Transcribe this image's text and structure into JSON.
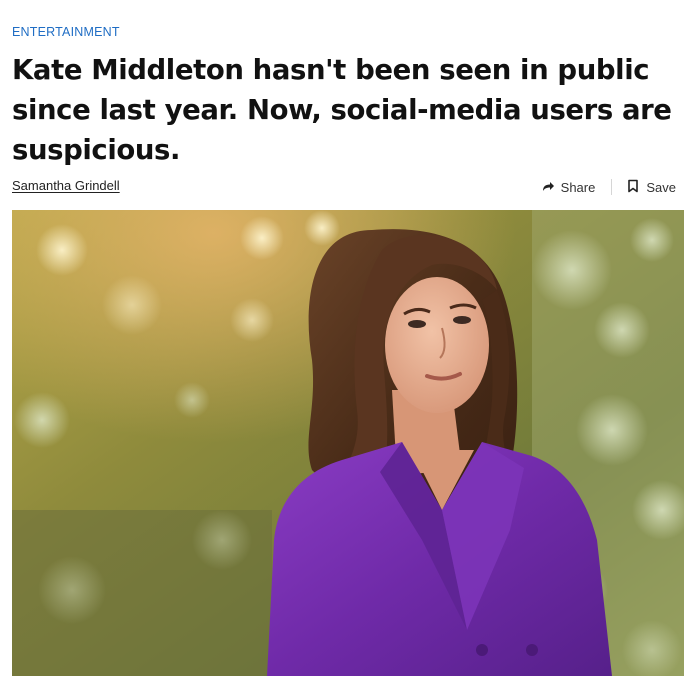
{
  "article": {
    "category": "ENTERTAINMENT",
    "headline": "Kate Middleton hasn't been seen in public since last year. Now, social-media users are suspicious.",
    "author": "Samantha Grindell"
  },
  "actions": {
    "share_label": "Share",
    "share_icon": "share-arrow-icon",
    "save_label": "Save",
    "save_icon": "bookmark-icon"
  },
  "colors": {
    "category": "#1f6dc4",
    "coat": "#6f2aa8"
  }
}
